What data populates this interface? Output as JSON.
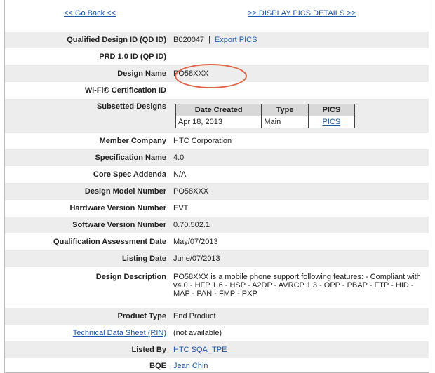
{
  "nav": {
    "back_label": "<< Go Back <<",
    "display_pics_label": ">> DISPLAY PICS DETAILS >>"
  },
  "fields": {
    "qd_id": {
      "label": "Qualified Design ID (QD ID)",
      "value": "B020047",
      "separator": "|",
      "export_label": "Export PICS"
    },
    "prd_id": {
      "label": "PRD 1.0 ID (QP ID)",
      "value": ""
    },
    "design_name": {
      "label": "Design Name",
      "value": "PO58XXX"
    },
    "wifi_id": {
      "label": "Wi-Fi® Certification ID",
      "value": ""
    },
    "subsetted": {
      "label": "Subsetted Designs",
      "headers": [
        "Date Created",
        "Type",
        "PICS"
      ],
      "rows": [
        {
          "date": "Apr 18, 2013",
          "type": "Main",
          "pics": "PICS"
        }
      ]
    },
    "member_company": {
      "label": "Member Company",
      "value": "HTC Corporation"
    },
    "spec_name": {
      "label": "Specification Name",
      "value": "4.0"
    },
    "core_spec": {
      "label": "Core Spec Addenda",
      "value": "N/A"
    },
    "model_number": {
      "label": "Design Model Number",
      "value": "PO58XXX"
    },
    "hw_version": {
      "label": "Hardware Version Number",
      "value": "EVT"
    },
    "sw_version": {
      "label": "Software Version Number",
      "value": "0.70.502.1"
    },
    "qa_date": {
      "label": "Qualification Assessment Date",
      "value": "May/07/2013"
    },
    "listing_date": {
      "label": "Listing Date",
      "value": "June/07/2013"
    },
    "description": {
      "label": "Design Description",
      "value": "PO58XXX is a mobile phone support following features: - Compliant with v4.0 - HFP 1.6 - HSP - A2DP - AVRCP 1.3 - OPP - PBAP - FTP - HID - MAP - PAN - FMP - PXP"
    },
    "product_type": {
      "label": "Product Type",
      "value": "End Product"
    },
    "tech_sheet": {
      "label": "Technical Data Sheet (RIN)",
      "value": "(not available)"
    },
    "listed_by": {
      "label": "Listed By",
      "value": "HTC SQA_TPE"
    },
    "bqe": {
      "label": "BQE",
      "value": "Jean Chin"
    }
  },
  "colors": {
    "link": "#1d57a8",
    "row_shade": "#ededed",
    "highlight_ellipse": "#e06245"
  }
}
